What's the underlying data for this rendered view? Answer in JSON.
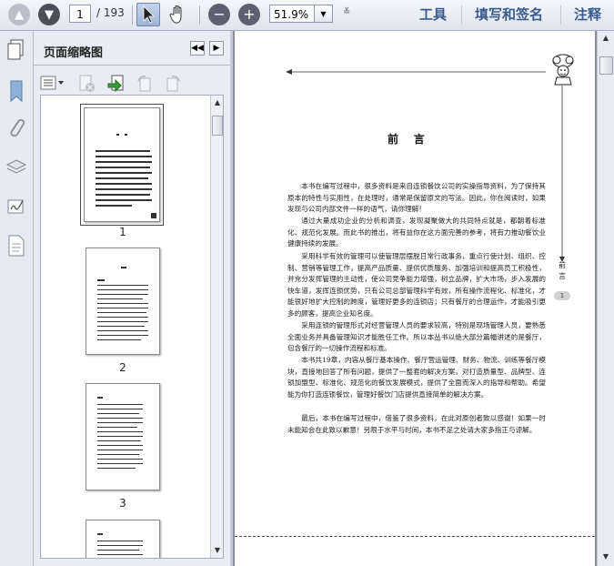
{
  "toolbar": {
    "page_current": "1",
    "page_total": "/ 193",
    "zoom": "51.9%",
    "menus": [
      "工具",
      "填写和签名",
      "注释"
    ]
  },
  "panel": {
    "title": "页面缩略图",
    "thumbnails": [
      {
        "label": "1"
      },
      {
        "label": "2"
      },
      {
        "label": "3"
      }
    ]
  },
  "document": {
    "heading": "前    言",
    "side_tab": "前\n言",
    "side_badge": "1",
    "paragraphs": [
      "本书在编写过程中，很多资料是来自连锁餐饮公司的实操指导资料，为了保持其原本的特性与实用性，在处理时，通常是保留原文的写法。因此，你在阅读时，如果发现与公司内部文件一样的语气，请你理解！",
      "通过大量成功企业的分析和调查，发现凝聚做大的共同特点就是，都朝着标准化、规范化发展。而此书的推出，将有益你在这方面完善的参考，将有力推动餐饮业健康持续的发展。",
      "采用科学有效的管理可以使管理层摆脱日常行政事务，重点行使计划、组织、控制、营销等管理工作，提高产品质量、提供优质服务、加强培训和提高员工积极性，并充分发挥管理的主动性，使公司竞争能力增强，树立品牌，扩大市场，步入发展的快车道，发挥连锁优势，只有公司总部管理科学有效，所有操作流程化、标准化，才能很好地扩大控制的跨度，管理好更多的连锁店；只有餐厅的合理运作，才能吸引更多的顾客，提高企业知名度。",
      "采用连锁的管理形式对经营管理人员的要求较高，特别是现场管理人员，要熟悉全面业务并具备管理知识才能胜任工作。所以本丛书以绝大部分篇幅讲述的是餐厅，包含餐厅的一切操作流程和标准。",
      "本书共19章，内容从餐厅基本操作、餐厅营运管理、财务、物流、训练等餐厅模块，直接地回答了所有问题，提供了一整套的解决方案，对打造质量型、品牌型、连锁加盟型、标准化、规范化的餐饮发展模式，提供了全面而深入的指导和帮助。希望能为你打造连锁餐饮，管理好餐饮门店提供直接简单的解决方案。",
      "最后，本书在编写过程中，借鉴了很多资料，在此对原创者致以感谢！如果一时未能知会在此致以歉意！另限于水平与时间，本书不足之处请大家多指正与谅解。"
    ]
  },
  "colors": {
    "toolbar_text": "#3b5a8c",
    "chrome_bg": "#d6dbe9"
  }
}
